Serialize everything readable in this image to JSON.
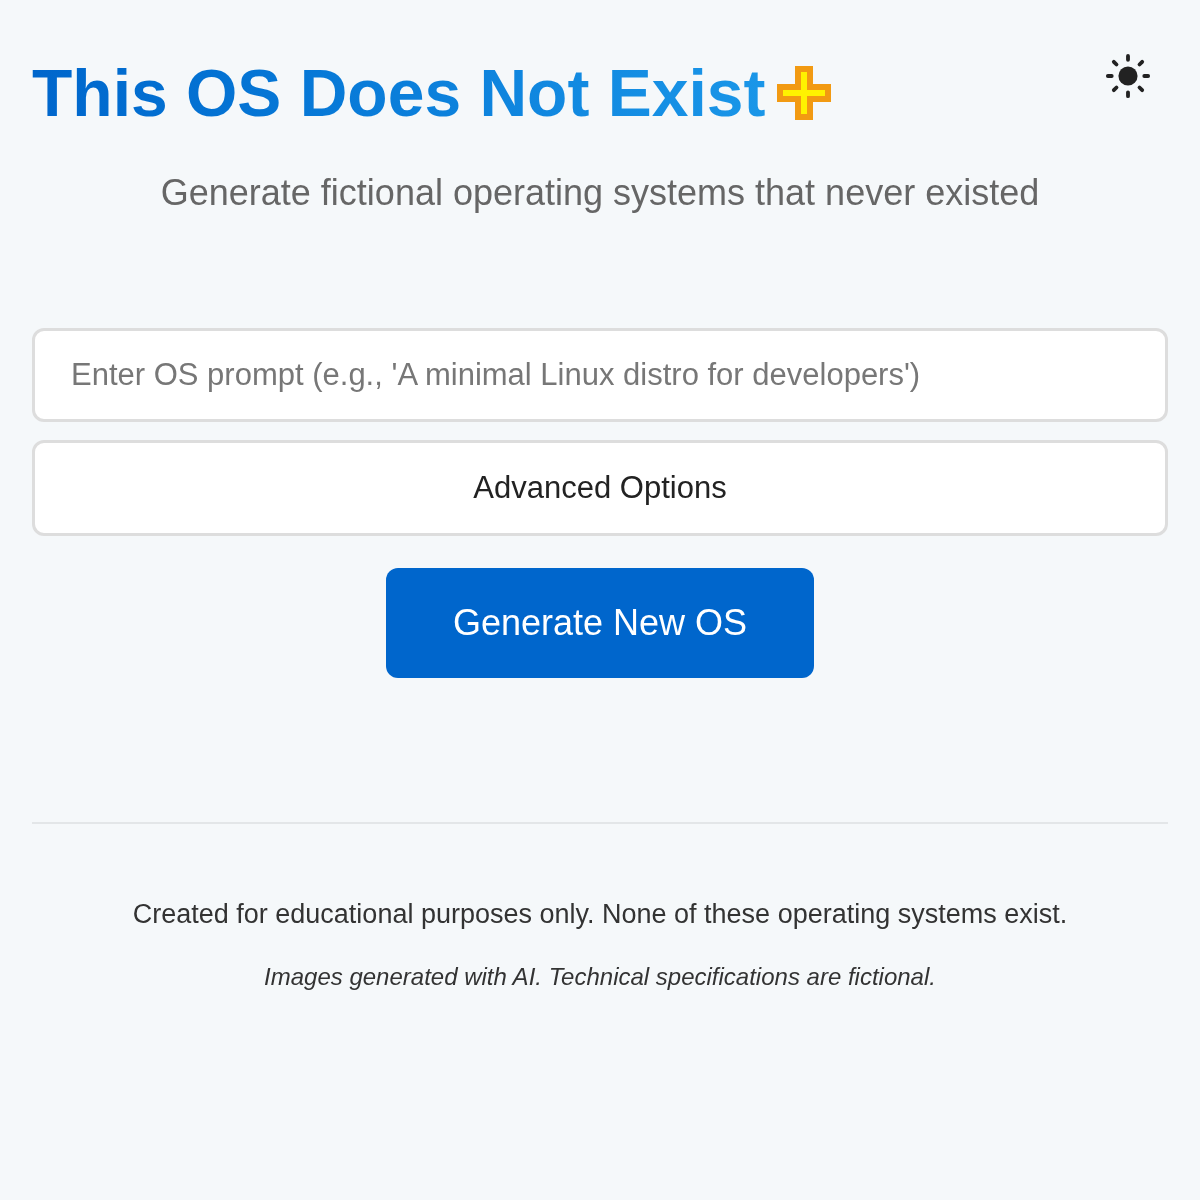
{
  "title": "This OS Does Not Exist",
  "subtitle": "Generate fictional operating systems that never existed",
  "prompt": {
    "placeholder": "Enter OS prompt (e.g., 'A minimal Linux distro for developers')"
  },
  "advanced_button": {
    "label": "Advanced Options"
  },
  "generate_button": {
    "label": "Generate New OS"
  },
  "footer": {
    "note": "Created for educational purposes only. None of these operating systems exist.",
    "disclaimer": "Images generated with AI. Technical specifications are fictional."
  }
}
